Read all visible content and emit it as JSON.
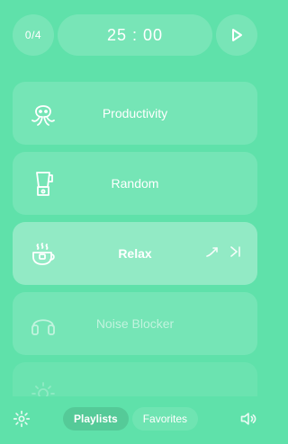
{
  "header": {
    "counter": "0/4",
    "timer": "25 : 00"
  },
  "playlists": [
    {
      "label": "Productivity",
      "icon": "octopus-icon"
    },
    {
      "label": "Random",
      "icon": "blender-icon"
    },
    {
      "label": "Relax",
      "icon": "tea-icon"
    },
    {
      "label": "Noise Blocker",
      "icon": "headphones-icon"
    },
    {
      "label": "",
      "icon": "sun-icon"
    }
  ],
  "footer": {
    "tabs": [
      {
        "label": "Playlists",
        "active": true
      },
      {
        "label": "Favorites",
        "active": false
      }
    ]
  },
  "colors": {
    "background": "#5fe1aa"
  }
}
